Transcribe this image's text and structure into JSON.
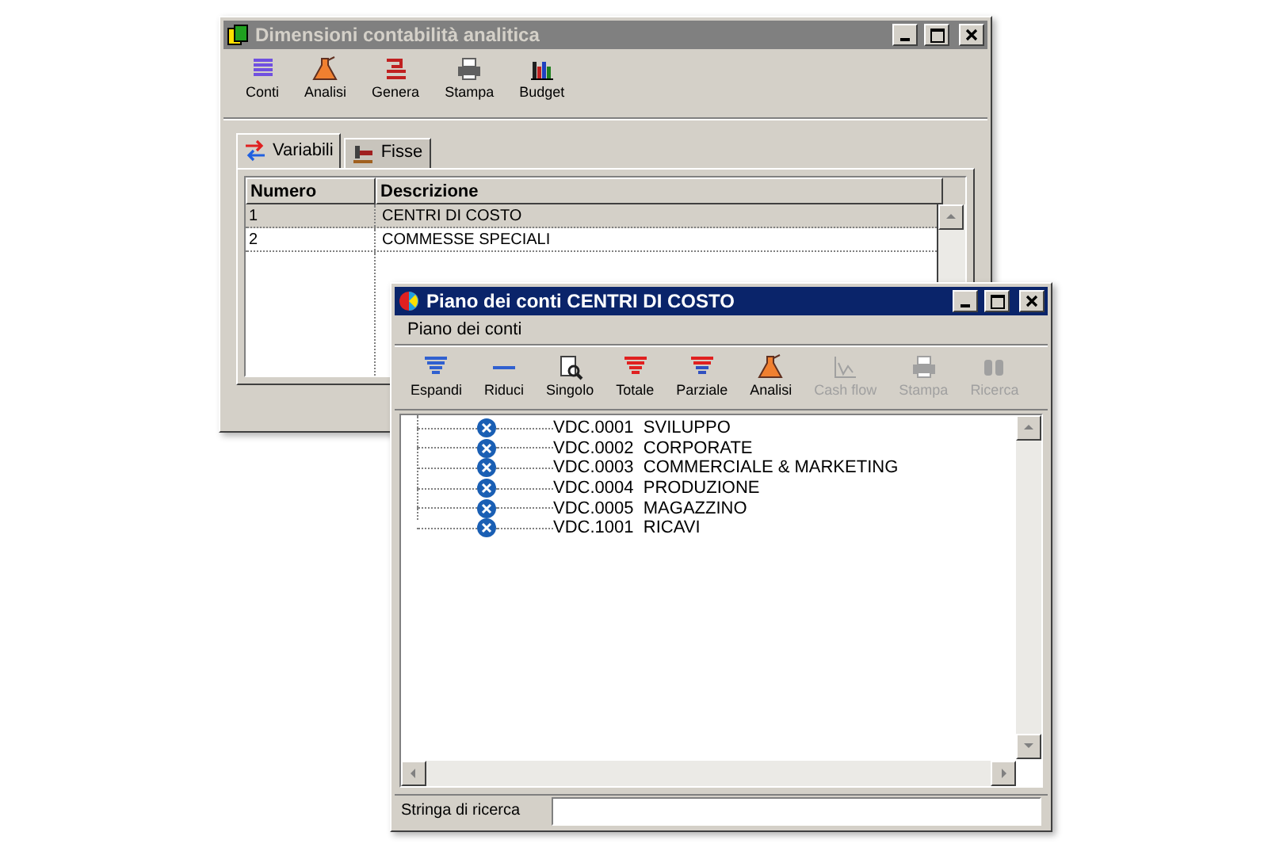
{
  "main_window": {
    "title": "Dimensioni contabilità analitica",
    "active": false,
    "toolbar": [
      {
        "label": "Conti",
        "disabled": false
      },
      {
        "label": "Analisi",
        "disabled": false
      },
      {
        "label": "Genera",
        "disabled": false
      },
      {
        "label": "Stampa",
        "disabled": false
      },
      {
        "label": "Budget",
        "disabled": false
      }
    ],
    "tabs": [
      {
        "label": "Variabili",
        "selected": true
      },
      {
        "label": "Fisse",
        "selected": false
      }
    ],
    "table": {
      "columns": [
        "Numero",
        "Descrizione"
      ],
      "rows": [
        {
          "cells": [
            "1",
            "CENTRI DI COSTO"
          ],
          "selected": true
        },
        {
          "cells": [
            "2",
            "COMMESSE SPECIALI"
          ],
          "selected": false
        }
      ]
    }
  },
  "chart_window": {
    "title": "Piano dei conti CENTRI DI COSTO",
    "active": true,
    "menu": [
      "Piano dei conti"
    ],
    "toolbar": [
      {
        "label": "Espandi",
        "disabled": false
      },
      {
        "label": "Riduci",
        "disabled": false
      },
      {
        "label": "Singolo",
        "disabled": false
      },
      {
        "label": "Totale",
        "disabled": false
      },
      {
        "label": "Parziale",
        "disabled": false
      },
      {
        "label": "Analisi",
        "disabled": false
      },
      {
        "label": "Cash flow",
        "disabled": true
      },
      {
        "label": "Stampa",
        "disabled": true
      },
      {
        "label": "Ricerca",
        "disabled": true
      }
    ],
    "tree": [
      {
        "code": "VDC.0001",
        "name": "SVILUPPO"
      },
      {
        "code": "VDC.0002",
        "name": "CORPORATE"
      },
      {
        "code": "VDC.0003",
        "name": "COMMERCIALE & MARKETING"
      },
      {
        "code": "VDC.0004",
        "name": "PRODUZIONE"
      },
      {
        "code": "VDC.0005",
        "name": "MAGAZZINO"
      },
      {
        "code": "VDC.1001",
        "name": "RICAVI"
      }
    ],
    "search": {
      "label": "Stringa di ricerca"
    }
  }
}
